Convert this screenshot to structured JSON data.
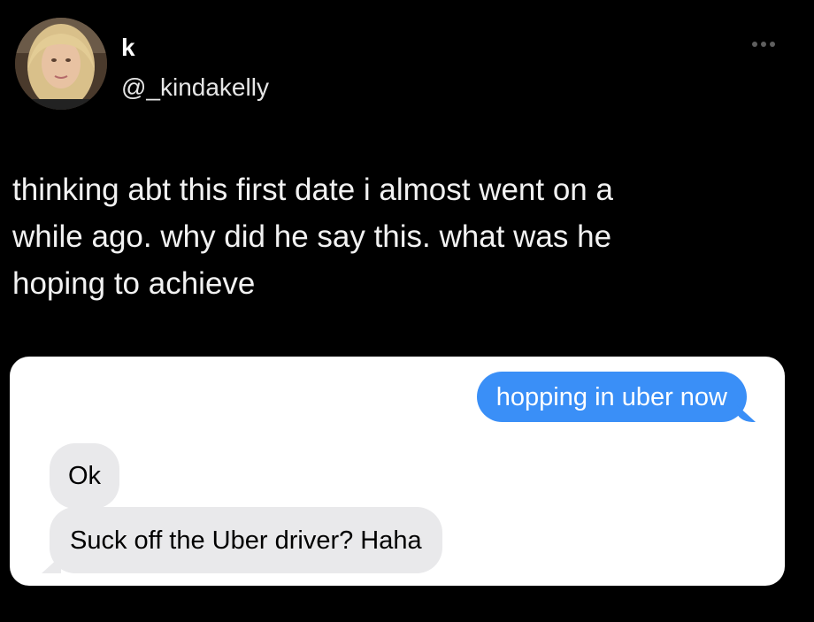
{
  "tweet": {
    "author": {
      "display_name": "k",
      "handle": "@_kindakelly",
      "avatar_icon": "profile-photo"
    },
    "more_icon": "more-horizontal-icon",
    "text": "thinking abt this first date i almost went on a\nwhile ago. why did he say this. what was he\nhoping to achieve"
  },
  "chat": {
    "messages": [
      {
        "direction": "sent",
        "text": "hopping in uber now"
      },
      {
        "direction": "received",
        "text": "Ok"
      },
      {
        "direction": "received",
        "text": "Suck off the Uber driver? Haha"
      }
    ],
    "colors": {
      "sent_bubble": "#3a8ff7",
      "received_bubble": "#e9e9eb",
      "card_background": "#ffffff"
    }
  }
}
